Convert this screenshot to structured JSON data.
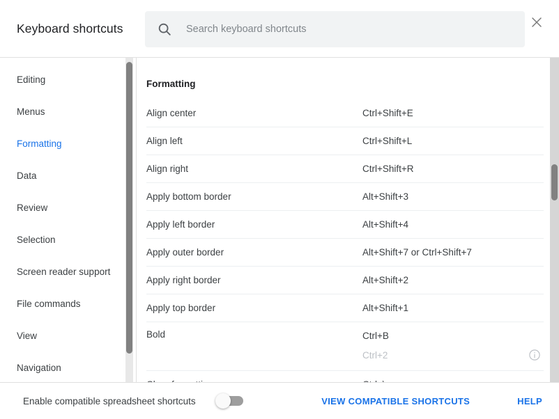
{
  "header": {
    "title": "Keyboard shortcuts",
    "search": {
      "placeholder": "Search keyboard shortcuts",
      "value": "",
      "icon": "search-icon"
    },
    "close_icon": "close-icon"
  },
  "sidebar": {
    "items": [
      {
        "label": "Editing",
        "active": false
      },
      {
        "label": "Menus",
        "active": false
      },
      {
        "label": "Formatting",
        "active": true
      },
      {
        "label": "Data",
        "active": false
      },
      {
        "label": "Review",
        "active": false
      },
      {
        "label": "Selection",
        "active": false
      },
      {
        "label": "Screen reader support",
        "active": false
      },
      {
        "label": "File commands",
        "active": false
      },
      {
        "label": "View",
        "active": false
      },
      {
        "label": "Navigation",
        "active": false
      }
    ]
  },
  "main": {
    "section_title": "Formatting",
    "rows": [
      {
        "label": "Align center",
        "keys": "Ctrl+Shift+E"
      },
      {
        "label": "Align left",
        "keys": "Ctrl+Shift+L"
      },
      {
        "label": "Align right",
        "keys": "Ctrl+Shift+R"
      },
      {
        "label": "Apply bottom border",
        "keys": "Alt+Shift+3"
      },
      {
        "label": "Apply left border",
        "keys": "Alt+Shift+4"
      },
      {
        "label": "Apply outer border",
        "keys": "Alt+Shift+7 or Ctrl+Shift+7"
      },
      {
        "label": "Apply right border",
        "keys": "Alt+Shift+2"
      },
      {
        "label": "Apply top border",
        "keys": "Alt+Shift+1"
      },
      {
        "label": "Bold",
        "keys": "Ctrl+B",
        "keys_alt": "Ctrl+2",
        "info_icon": "info-icon"
      },
      {
        "label": "Clear formatting",
        "keys": "Ctrl+\\"
      }
    ]
  },
  "footer": {
    "toggle_label": "Enable compatible spreadsheet shortcuts",
    "toggle_state": "off",
    "view_label": "VIEW COMPATIBLE SHORTCUTS",
    "help_label": "HELP"
  },
  "colors": {
    "accent": "#1a73e8",
    "text": "#3c4043",
    "muted": "#bdc1c6",
    "search_bg": "#f1f3f4",
    "divider": "#e0e0e0"
  }
}
